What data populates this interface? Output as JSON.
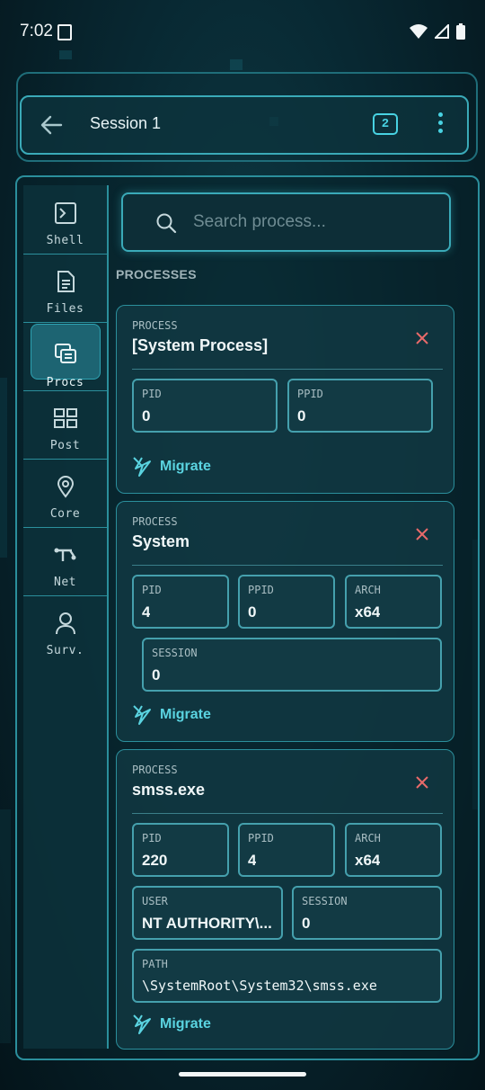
{
  "status_bar": {
    "time": "7:02"
  },
  "header": {
    "title": "Session 1",
    "badge": "2"
  },
  "sidebar": {
    "items": [
      {
        "label": "Shell",
        "icon": "terminal-icon"
      },
      {
        "label": "Files",
        "icon": "file-icon"
      },
      {
        "label": "Procs",
        "icon": "processes-icon",
        "active": true
      },
      {
        "label": "Post",
        "icon": "grid-icon"
      },
      {
        "label": "Core",
        "icon": "location-pin-icon"
      },
      {
        "label": "Net",
        "icon": "network-icon"
      },
      {
        "label": "Surv.",
        "icon": "person-icon"
      }
    ]
  },
  "search": {
    "placeholder": "Search process..."
  },
  "section_header": "PROCESSES",
  "process_label": "PROCESS",
  "migrate_label": "Migrate",
  "processes": [
    {
      "name": "[System Process]",
      "fields": [
        {
          "label": "PID",
          "value": "0"
        },
        {
          "label": "PPID",
          "value": "0"
        }
      ]
    },
    {
      "name": "System",
      "fields": [
        {
          "label": "PID",
          "value": "4"
        },
        {
          "label": "PPID",
          "value": "0"
        },
        {
          "label": "ARCH",
          "value": "x64"
        },
        {
          "label": "SESSION",
          "value": "0"
        }
      ]
    },
    {
      "name": "smss.exe",
      "fields": [
        {
          "label": "PID",
          "value": "220"
        },
        {
          "label": "PPID",
          "value": "4"
        },
        {
          "label": "ARCH",
          "value": "x64"
        },
        {
          "label": "USER",
          "value": "NT AUTHORITY\\..."
        },
        {
          "label": "SESSION",
          "value": "0"
        },
        {
          "label": "PATH",
          "value": "\\SystemRoot\\System32\\smss.exe"
        }
      ]
    }
  ],
  "colors": {
    "accent": "#48d2e2",
    "close": "#e86a6a",
    "background": "#082832"
  }
}
